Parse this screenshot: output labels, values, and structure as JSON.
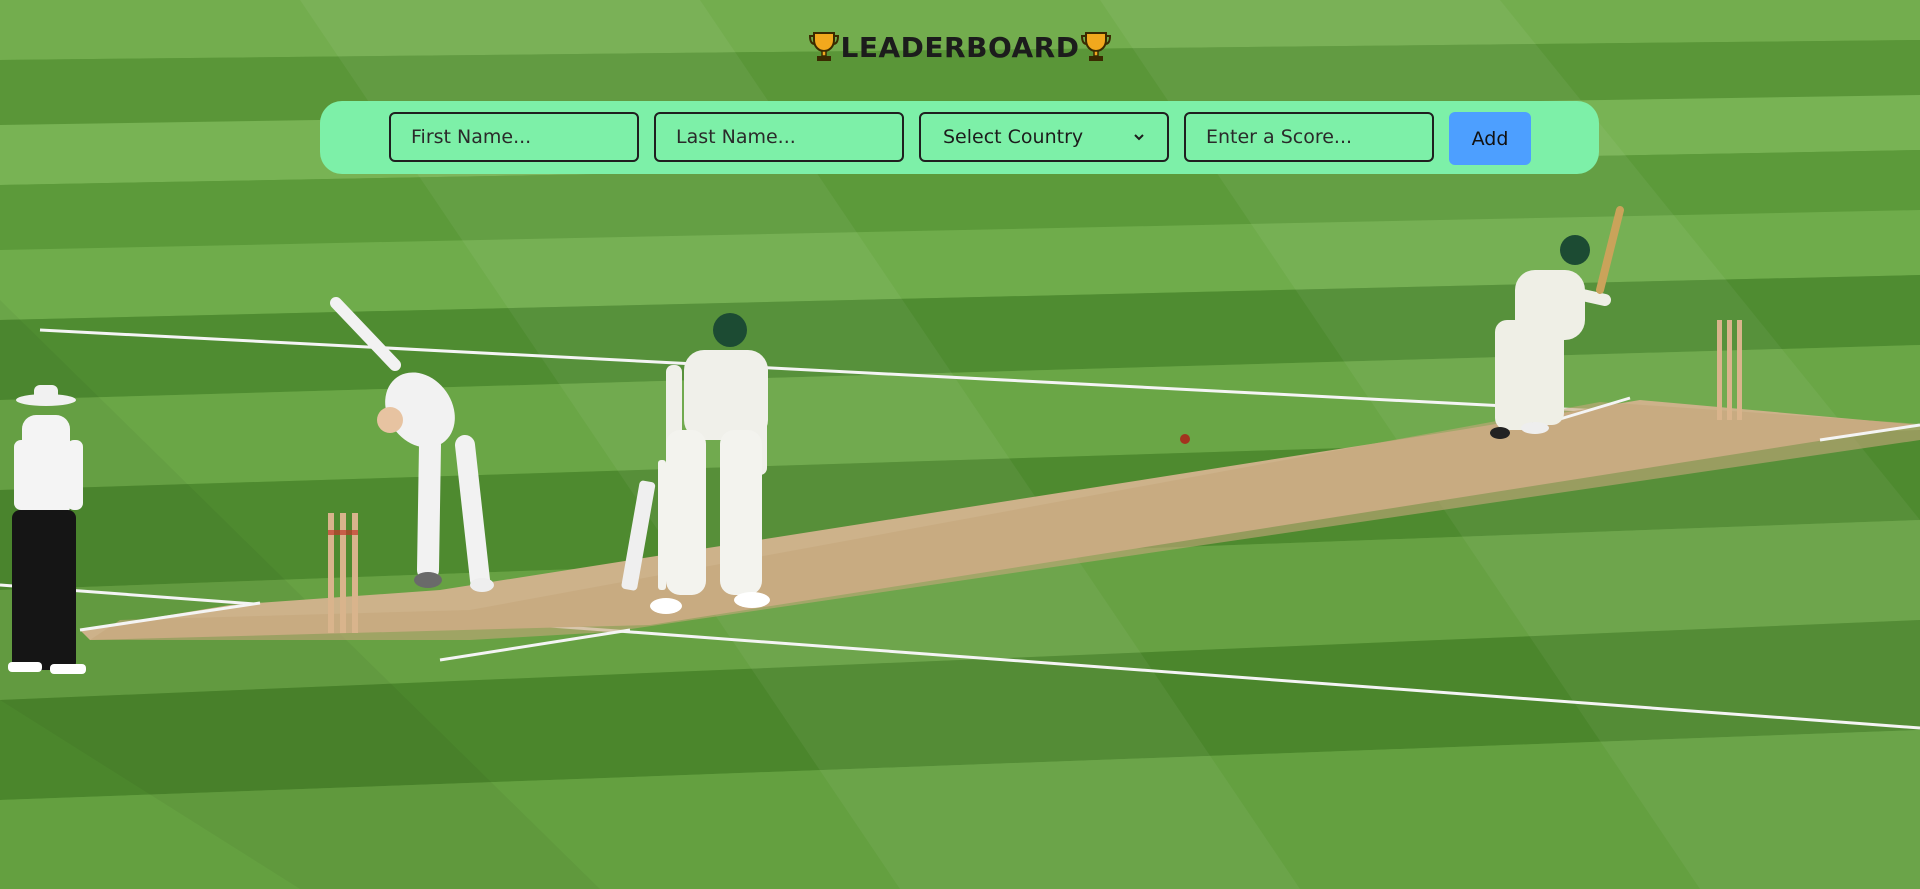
{
  "header": {
    "title": "LEADERBOARD",
    "left_icon": "trophy-icon",
    "right_icon": "trophy-icon"
  },
  "form": {
    "first_name_placeholder": "First Name...",
    "last_name_placeholder": "Last Name...",
    "country_selected": "Select Country",
    "score_placeholder": "Enter a Score...",
    "add_label": "Add"
  },
  "background": {
    "description_icon": "cricket-pitch-photo"
  },
  "colors": {
    "form_bar": "#7df0a8",
    "add_button": "#4d9fff",
    "trophy": "#f2a81d"
  }
}
